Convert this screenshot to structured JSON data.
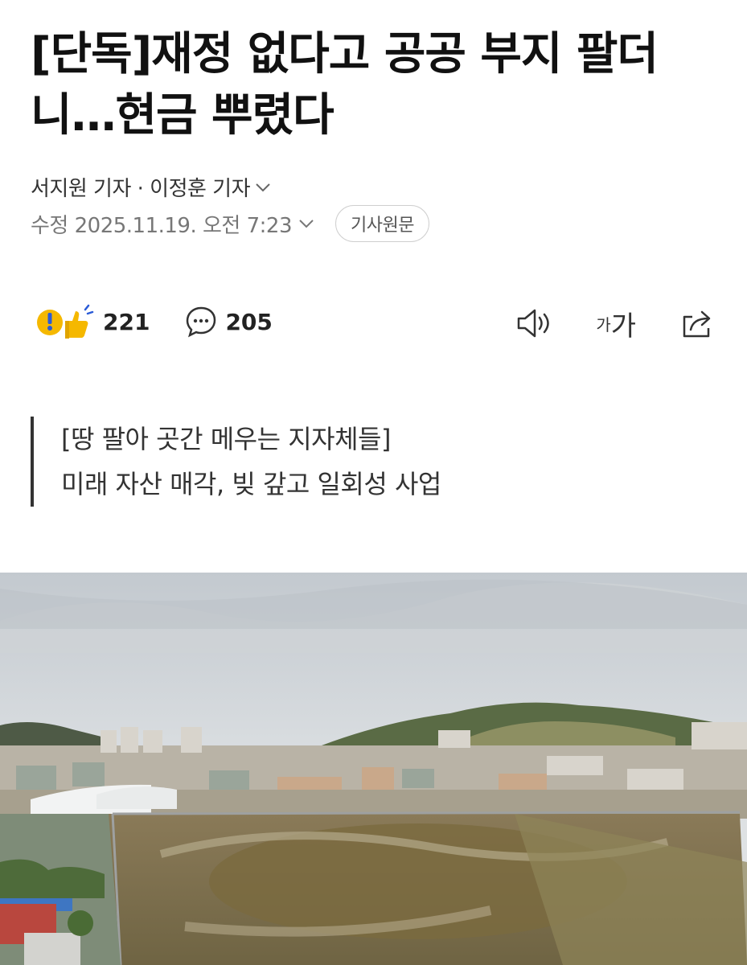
{
  "article": {
    "title": "[단독]재정 없다고 공공 부지 팔더니…현금 뿌렸다",
    "reporters": "서지원 기자 · 이정훈 기자",
    "modified": "수정 2025.11.19. 오전 7:23",
    "original_button": "기사원문"
  },
  "reactions": {
    "empathy_count": "221",
    "comment_count": "205"
  },
  "toolbar": {
    "font_small": "가",
    "font_large": "가",
    "icons": [
      "speaker-icon",
      "font-size-icon",
      "share-icon"
    ]
  },
  "summary": {
    "line1": "[땅 팔아 곳간 메우는 지자체들]",
    "line2": "미래 자산 매각, 빚 갚고 일회성 사업"
  },
  "colors": {
    "accent_yellow": "#f5b800",
    "text_primary": "#111111",
    "text_muted": "#777777",
    "divider": "#333333"
  }
}
